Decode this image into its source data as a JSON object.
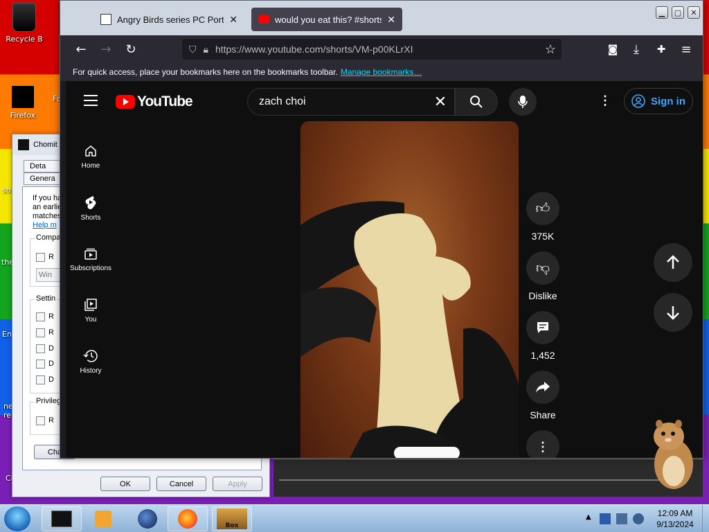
{
  "desktop": {
    "icons": [
      {
        "label": "Recycle B"
      },
      {
        "label": "Firefox"
      }
    ],
    "fragments": [
      "Fo",
      "so",
      "the",
      "En",
      "ne re",
      "Cl"
    ]
  },
  "properties_dialog": {
    "title": "Chomit",
    "tabs": [
      "Deta",
      "Genera"
    ],
    "intro_lines": [
      "If you ha",
      "an earlie",
      "matches"
    ],
    "help_link": "Help m",
    "groups": {
      "compat": {
        "label": "Compa",
        "row": "R",
        "select_value": "Win"
      },
      "settings": {
        "label": "Settin",
        "rows": [
          "R",
          "R",
          "D",
          "D",
          "D"
        ]
      },
      "privilege": {
        "label": "Privileg",
        "row": "R"
      }
    },
    "change_button": "Cha",
    "buttons": {
      "ok": "OK",
      "cancel": "Cancel",
      "apply": "Apply"
    }
  },
  "browser": {
    "tabs": [
      {
        "label": "Angry Birds series PC Ports : Ro",
        "close": "✕"
      },
      {
        "label": "would you eat this? #shorts - Yo",
        "close": "✕"
      }
    ],
    "url": "https://www.youtube.com/shorts/VM-p00KLrXI",
    "bookmarks_message": "For quick access, place your bookmarks here on the bookmarks toolbar.",
    "bookmarks_link": "Manage bookmarks…"
  },
  "youtube": {
    "logo_text": "YouTube",
    "search": {
      "value": "zach choi"
    },
    "sign_in": "Sign in",
    "sidebar": [
      {
        "label": "Home",
        "icon": "home-icon"
      },
      {
        "label": "Shorts",
        "icon": "shorts-icon"
      },
      {
        "label": "Subscriptions",
        "icon": "subscriptions-icon"
      },
      {
        "label": "You",
        "icon": "you-icon"
      },
      {
        "label": "History",
        "icon": "history-icon"
      }
    ],
    "actions": {
      "like": "375K",
      "dislike": "Dislike",
      "comments": "1,452",
      "share": "Share"
    }
  },
  "taskbar": {
    "time": "12:09 AM",
    "date": "9/13/2024",
    "items": [
      "cmd-window",
      "media-player",
      "globe-app",
      "firefox",
      "box"
    ],
    "box_label": "Box"
  }
}
